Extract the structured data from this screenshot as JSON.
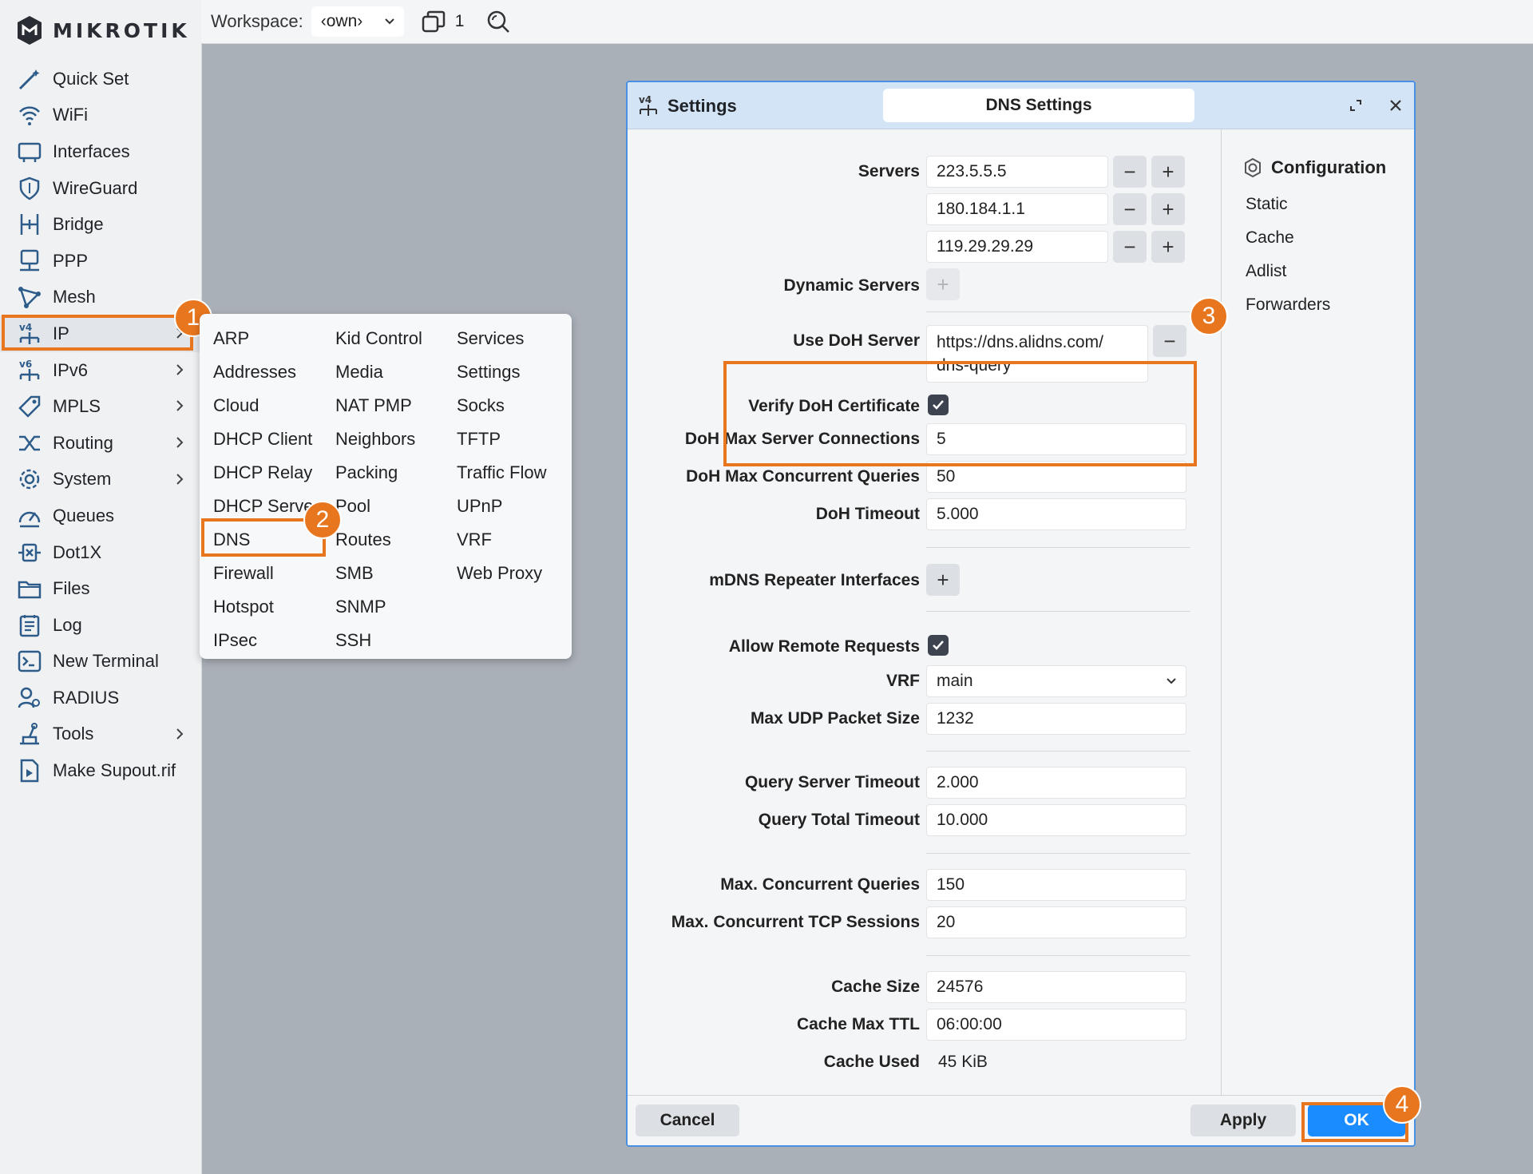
{
  "brand": {
    "name": "MIKROTIK"
  },
  "topbar": {
    "workspace_label": "Workspace:",
    "workspace_value": "‹own›",
    "window_count": "1"
  },
  "sidebar": {
    "items": [
      {
        "label": "Quick Set",
        "icon": "magic-wand-icon"
      },
      {
        "label": "WiFi",
        "icon": "wifi-icon"
      },
      {
        "label": "Interfaces",
        "icon": "interfaces-icon"
      },
      {
        "label": "WireGuard",
        "icon": "shield-icon"
      },
      {
        "label": "Bridge",
        "icon": "bridge-icon"
      },
      {
        "label": "PPP",
        "icon": "ppp-icon"
      },
      {
        "label": "Mesh",
        "icon": "mesh-icon"
      },
      {
        "label": "IP",
        "icon": "ipv4-icon"
      },
      {
        "label": "IPv6",
        "icon": "ipv6-icon"
      },
      {
        "label": "MPLS",
        "icon": "tag-icon"
      },
      {
        "label": "Routing",
        "icon": "routing-icon"
      },
      {
        "label": "System",
        "icon": "gear-icon"
      },
      {
        "label": "Queues",
        "icon": "gauge-icon"
      },
      {
        "label": "Dot1X",
        "icon": "dot1x-icon"
      },
      {
        "label": "Files",
        "icon": "folder-icon"
      },
      {
        "label": "Log",
        "icon": "log-icon"
      },
      {
        "label": "New Terminal",
        "icon": "terminal-icon"
      },
      {
        "label": "RADIUS",
        "icon": "radius-icon"
      },
      {
        "label": "Tools",
        "icon": "tools-icon"
      },
      {
        "label": "Make Supout.rif",
        "icon": "file-icon"
      }
    ]
  },
  "ip_menu": {
    "col1": [
      "ARP",
      "Addresses",
      "Cloud",
      "DHCP Client",
      "DHCP Relay",
      "DHCP Server",
      "DNS",
      "Firewall",
      "Hotspot",
      "IPsec"
    ],
    "col2": [
      "Kid Control",
      "Media",
      "NAT PMP",
      "Neighbors",
      "Packing",
      "Pool",
      "Routes",
      "SMB",
      "SNMP",
      "SSH"
    ],
    "col3": [
      "Services",
      "Settings",
      "Socks",
      "TFTP",
      "Traffic Flow",
      "UPnP",
      "VRF",
      "Web Proxy"
    ]
  },
  "steps": [
    "1",
    "2",
    "3",
    "4"
  ],
  "dialog": {
    "title": "Settings",
    "tab": "DNS Settings",
    "servers_label": "Servers",
    "servers": [
      "223.5.5.5",
      "180.184.1.1",
      "119.29.29.29"
    ],
    "dynamic_servers_label": "Dynamic Servers",
    "use_doh_label": "Use DoH Server",
    "use_doh_value_line1": "https://dns.alidns.com/",
    "use_doh_value_line2": "dns-query",
    "verify_doh_label": "Verify DoH Certificate",
    "verify_doh_checked": true,
    "doh_max_conn_label": "DoH Max Server Connections",
    "doh_max_conn": "5",
    "doh_max_q_label": "DoH Max Concurrent Queries",
    "doh_max_q": "50",
    "doh_timeout_label": "DoH Timeout",
    "doh_timeout": "5.000",
    "mdns_label": "mDNS Repeater Interfaces",
    "allow_remote_label": "Allow Remote Requests",
    "allow_remote_checked": true,
    "vrf_label": "VRF",
    "vrf_value": "main",
    "max_udp_label": "Max UDP Packet Size",
    "max_udp": "1232",
    "qst_label": "Query Server Timeout",
    "qst": "2.000",
    "qtt_label": "Query Total Timeout",
    "qtt": "10.000",
    "mcq_label": "Max. Concurrent Queries",
    "mcq": "150",
    "mcts_label": "Max. Concurrent TCP Sessions",
    "mcts": "20",
    "cache_size_label": "Cache Size",
    "cache_size": "24576",
    "cache_ttl_label": "Cache Max TTL",
    "cache_ttl": "06:00:00",
    "cache_used_label": "Cache Used",
    "cache_used": "45 KiB",
    "side_heading": "Configuration",
    "side_items": [
      "Static",
      "Cache",
      "Adlist",
      "Forwarders"
    ],
    "cancel": "Cancel",
    "apply": "Apply",
    "ok": "OK"
  },
  "colors": {
    "highlight": "#e8761f",
    "primary": "#1a8cff",
    "header": "#d4e4f7"
  }
}
